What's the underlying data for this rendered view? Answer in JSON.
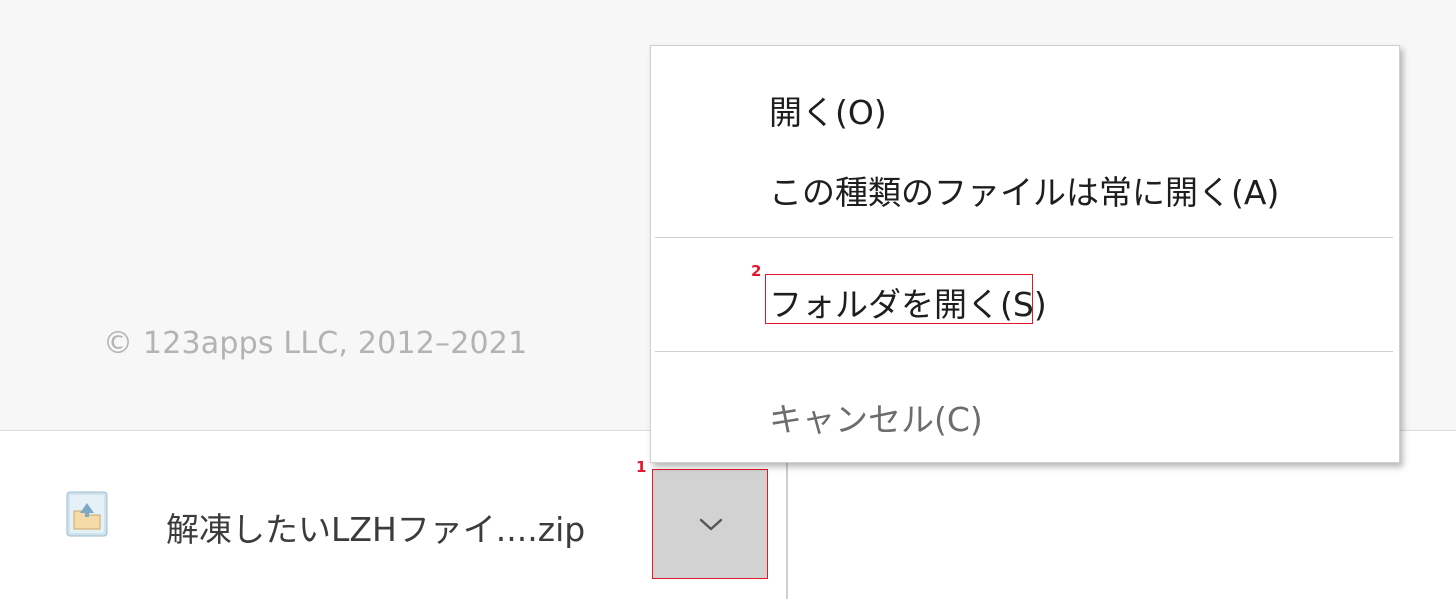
{
  "footer": {
    "copyright": "© 123apps LLC, 2012–2021"
  },
  "download_shelf": {
    "file_name": "解凍したいLZHファイ....zip",
    "file_icon": "archive-file-icon",
    "menu_button_icon": "chevron-down-icon"
  },
  "context_menu": {
    "items": [
      {
        "label": "開く(O)",
        "enabled": true
      },
      {
        "label": "この種類のファイルは常に開く(A)",
        "enabled": true
      },
      {
        "label": "フォルダを開く(S)",
        "enabled": true
      },
      {
        "label": "キャンセル(C)",
        "enabled": false
      }
    ]
  },
  "annotations": {
    "step1": "1",
    "step2": "2",
    "color": "#e0182e"
  }
}
